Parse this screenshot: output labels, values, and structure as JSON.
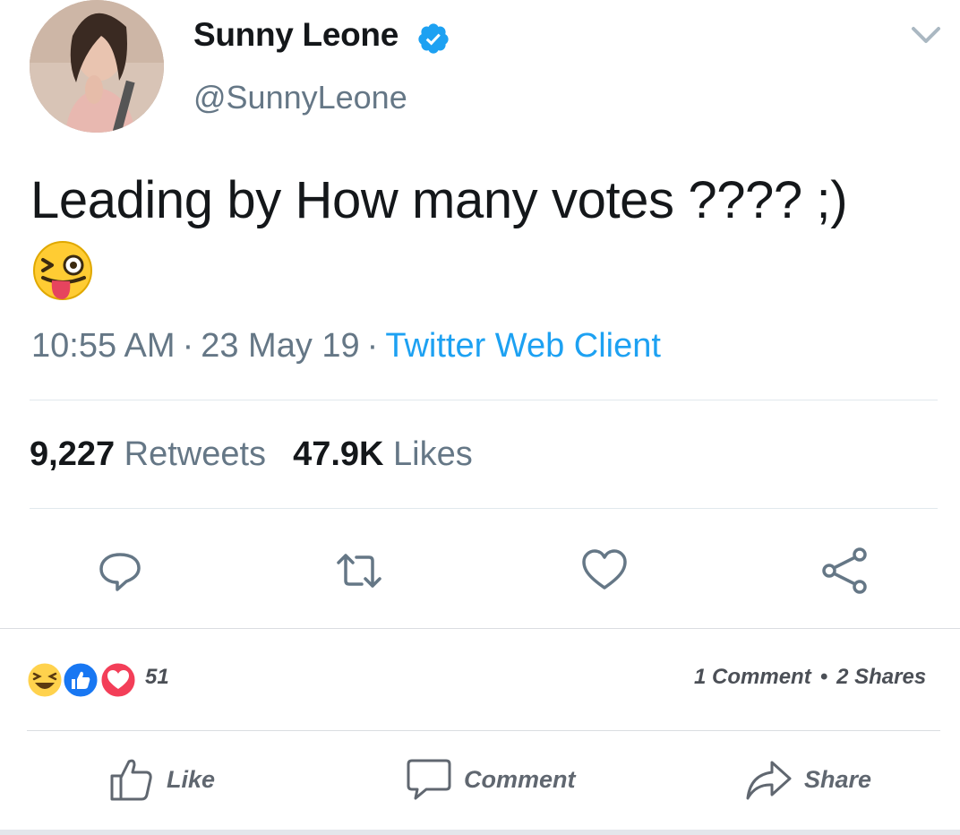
{
  "tweet": {
    "display_name": "Sunny Leone",
    "handle": "@SunnyLeone",
    "text": "Leading by How many votes ???? ;)",
    "emoji": "winking-face-with-tongue",
    "time": "10:55 AM",
    "date": "23 May 19",
    "separator": "·",
    "client": "Twitter Web Client",
    "retweets_count": "9,227",
    "retweets_label": "Retweets",
    "likes_count": "47.9K",
    "likes_label": "Likes"
  },
  "tweet_actions": [
    "reply-icon",
    "retweet-icon",
    "like-icon",
    "share-icon"
  ],
  "facebook": {
    "reactions": [
      "haha",
      "like",
      "love"
    ],
    "reaction_count": "51",
    "comments": "1 Comment",
    "dot": "•",
    "shares": "2 Shares",
    "buttons": {
      "like": "Like",
      "comment": "Comment",
      "share": "Share"
    }
  },
  "colors": {
    "twitter_blue": "#1da1f2",
    "muted_gray": "#657786",
    "fb_blue": "#1877f2",
    "fb_love": "#f33e58"
  }
}
